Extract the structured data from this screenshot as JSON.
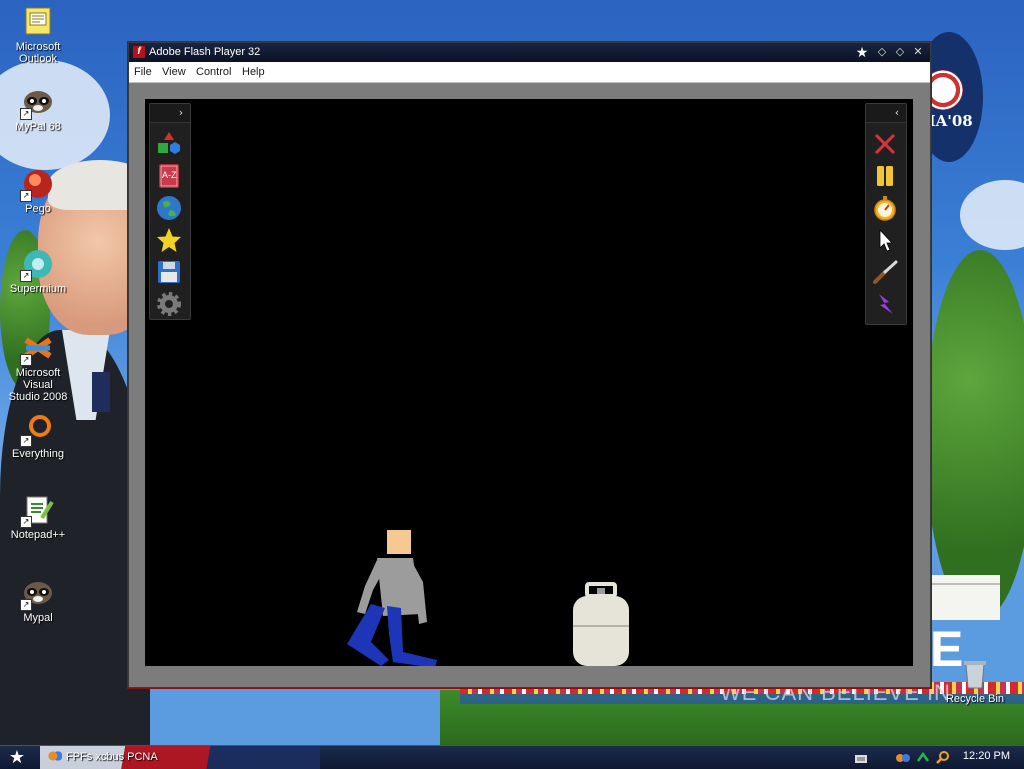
{
  "desktop": {
    "icons": [
      {
        "label_lines": [
          "Microsoft",
          "Outlook"
        ],
        "icon": "outlook-icon"
      },
      {
        "label_lines": [
          "MyPal 68"
        ],
        "icon": "mypal-icon"
      },
      {
        "label_lines": [
          "Pego"
        ],
        "icon": "pego-icon"
      },
      {
        "label_lines": [
          "Supermium"
        ],
        "icon": "supermium-icon"
      },
      {
        "label_lines": [
          "Microsoft Visual",
          "Studio 2008"
        ],
        "icon": "visual-studio-icon"
      },
      {
        "label_lines": [
          "Everything"
        ],
        "icon": "everything-icon"
      },
      {
        "label_lines": [
          "Notepad++"
        ],
        "icon": "notepadpp-icon"
      },
      {
        "label_lines": [
          "Mypal"
        ],
        "icon": "mypal-icon"
      }
    ],
    "recycle_bin": {
      "label": "Recycle Bin",
      "icon": "recycle-bin-icon"
    },
    "wallpaper": {
      "logo_text": "MA'08",
      "slogan": "WE CAN BELIEVE IN",
      "slogan_fragment": "E"
    }
  },
  "window": {
    "title": "Adobe Flash Player 32",
    "app_icon_glyph": "f",
    "menu": [
      "File",
      "View",
      "Control",
      "Help"
    ],
    "accent": "#b3121b"
  },
  "game": {
    "left_panel": {
      "toggle": "›",
      "tools": [
        "shapes-icon",
        "a-z-icon",
        "globe-icon",
        "star-icon",
        "save-icon",
        "settings-gear-icon"
      ],
      "az_text": "A-Z"
    },
    "right_panel": {
      "toggle": "‹",
      "tools": [
        "close-x-icon",
        "pause-icon",
        "stopwatch-icon",
        "pointer-icon",
        "knife-icon",
        "lightning-icon"
      ]
    },
    "colors": {
      "stage": "#000000",
      "ragdoll_shirt": "#9c9c9c",
      "ragdoll_pants": "#1d36b8",
      "ragdoll_head": "#f6c892",
      "tank": "#e6e3d8"
    }
  },
  "taskbar": {
    "task_label": "FPFs xcbus PCNA",
    "clock": "12:20 PM"
  }
}
